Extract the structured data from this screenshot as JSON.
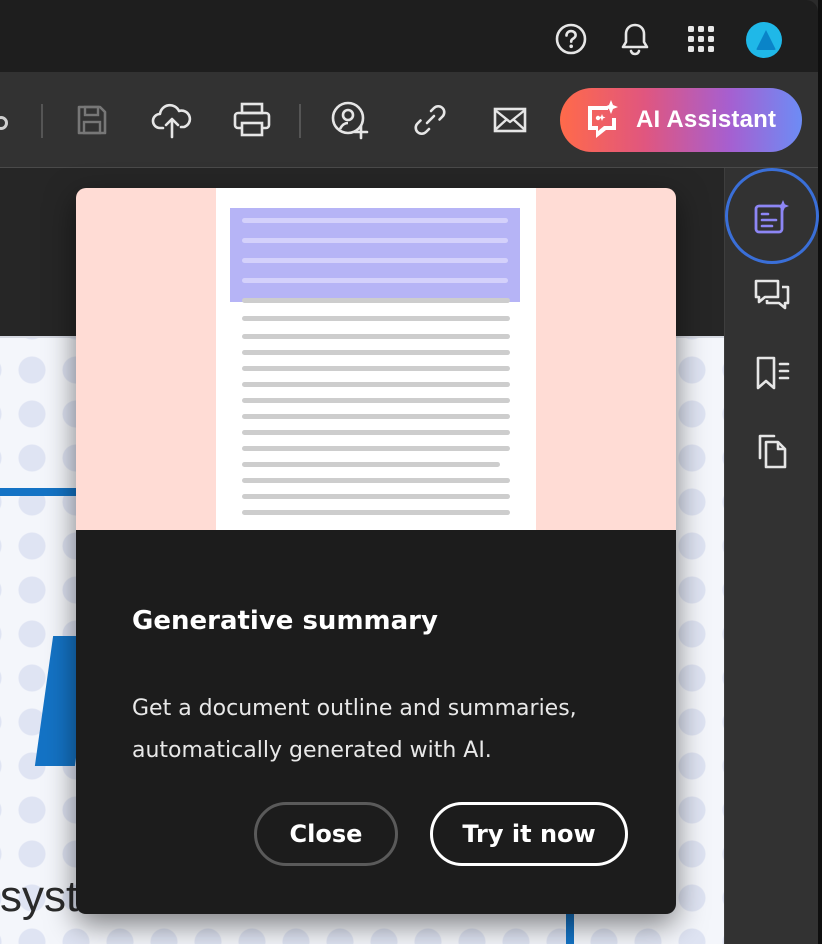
{
  "header": {
    "icons": [
      "help-icon",
      "bell-icon",
      "apps-grid-icon",
      "avatar"
    ]
  },
  "toolbar": {
    "ai_assistant_label": "AI Assistant",
    "icons": [
      "search-icon",
      "save-icon",
      "upload-cloud-icon",
      "print-icon",
      "share-user-icon",
      "link-icon",
      "mail-icon"
    ]
  },
  "right_rail": {
    "items": [
      "generative-summary-icon",
      "comments-icon",
      "bookmarks-icon",
      "pages-icon"
    ],
    "active": "generative-summary-icon"
  },
  "document": {
    "visible_text_fragment": "syste"
  },
  "popover": {
    "title": "Generative summary",
    "body_line1": "Get a document outline and summaries,",
    "body_line2": "automatically generated with AI.",
    "close_label": "Close",
    "try_label": "Try it now"
  },
  "colors": {
    "accent_blue": "#3a6fd8",
    "ai_gradient_start": "#ff6a4a",
    "ai_gradient_end": "#6d8cf5",
    "illustration_bg": "#ffdcd5",
    "illustration_highlight": "#b6b4f6"
  }
}
